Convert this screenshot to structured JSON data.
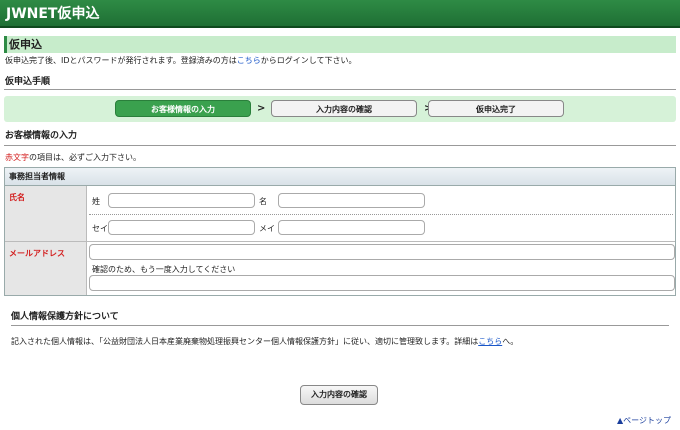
{
  "app": {
    "title": "JWNET仮申込"
  },
  "section": {
    "title": "仮申込"
  },
  "intro": {
    "before_link": "仮申込完了後、IDとパスワードが発行されます。登録済みの方は",
    "link": "こちら",
    "after_link": "からログインして下さい。"
  },
  "steps": {
    "heading": "仮申込手順",
    "items": [
      "お客様情報の入力",
      "入力内容の確認",
      "仮申込完了"
    ],
    "separator": ">"
  },
  "customer": {
    "heading": "お客様情報の入力",
    "required_note_red": "赤文字",
    "required_note_rest": "の項目は、必ずご入力下さい。"
  },
  "form": {
    "section_title": "事務担当者情報",
    "name_label": "氏名",
    "sei_label": "姓",
    "mei_label": "名",
    "sei_kana_label": "セイ",
    "mei_kana_label": "メイ",
    "email_label": "メールアドレス",
    "confirm_hint": "確認のため、もう一度入力してください",
    "values": {
      "sei": "",
      "mei": "",
      "sei_kana": "",
      "mei_kana": "",
      "email": "",
      "email_confirm": ""
    }
  },
  "privacy": {
    "heading": "個人情報保護方針について",
    "text_before": "記入された個人情報は、「公益財団法人日本産業廃棄物処理振興センター個人情報保護方針」に従い、適切に管理致します。詳細は",
    "link": "こちら",
    "text_after": "へ。"
  },
  "actions": {
    "confirm_label": "入力内容の確認"
  },
  "footer": {
    "pagetop": "▲ページトップ"
  }
}
